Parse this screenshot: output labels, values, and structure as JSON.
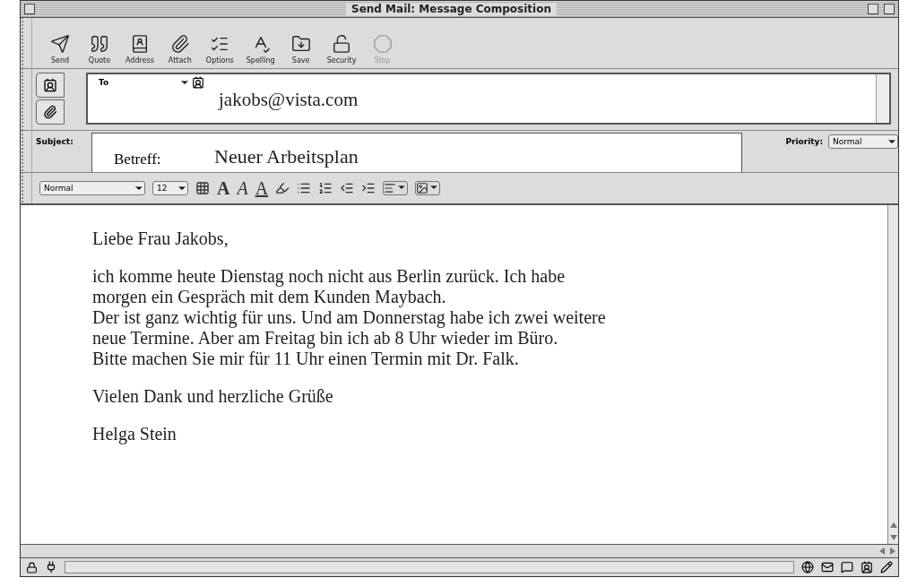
{
  "window": {
    "title": "Send Mail: Message Composition"
  },
  "toolbar": [
    {
      "label": "Send",
      "kind": "send",
      "disabled": false
    },
    {
      "label": "Quote",
      "kind": "quote",
      "disabled": false
    },
    {
      "label": "Address",
      "kind": "address",
      "disabled": false
    },
    {
      "label": "Attach",
      "kind": "attach",
      "disabled": false
    },
    {
      "label": "Options",
      "kind": "options",
      "disabled": false
    },
    {
      "label": "Spelling",
      "kind": "spelling",
      "disabled": false
    },
    {
      "label": "Save",
      "kind": "save",
      "disabled": false
    },
    {
      "label": "Security",
      "kind": "security",
      "disabled": false
    },
    {
      "label": "Stop",
      "kind": "stop",
      "disabled": true
    }
  ],
  "address": {
    "field_label": "To",
    "value": "jakobs@vista.com"
  },
  "subject": {
    "label": "Subject:",
    "prefix": "Betreff:",
    "value": "Neuer Arbeitsplan"
  },
  "priority": {
    "label": "Priority:",
    "value": "Normal"
  },
  "format_bar": {
    "style": "Normal",
    "size": "12",
    "glyphs": [
      {
        "text": "A",
        "kind": "bold"
      },
      {
        "text": "A",
        "kind": "italic"
      },
      {
        "text": "A",
        "kind": "underline"
      }
    ]
  },
  "body": [
    {
      "lines": [
        "Liebe Frau Jakobs,"
      ]
    },
    {
      "lines": [
        "ich komme heute Dienstag noch nicht aus Berlin zurück. Ich habe",
        "morgen ein Gespräch mit dem Kunden Maybach.",
        "Der ist ganz wichtig für uns. Und am Donnerstag habe ich zwei weitere",
        "neue Termine. Aber am Freitag bin ich ab 8 Uhr wieder im Büro.",
        "Bitte machen Sie mir für 11 Uhr einen Termin mit Dr. Falk."
      ]
    },
    {
      "lines": [
        "Vielen Dank und herzliche Grüße"
      ]
    },
    {
      "lines": [
        "Helga Stein"
      ]
    }
  ]
}
